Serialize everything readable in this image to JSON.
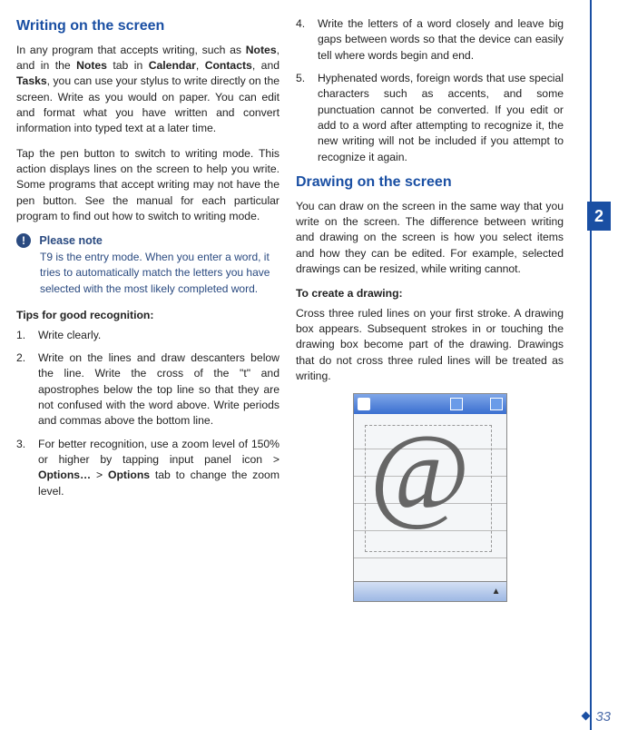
{
  "col1": {
    "h_writing": "Writing on the screen",
    "p1a": "In any program that accepts writing, such as ",
    "p1b_bold": "Notes",
    "p1c": ", and in the ",
    "p1d_bold": "Notes",
    "p1e": " tab in ",
    "p1f_bold": "Calendar",
    "p1g": ", ",
    "p1h_bold": "Contacts",
    "p1i": ", and ",
    "p1j_bold": "Tasks",
    "p1k": ", you can use your stylus to write directly on the screen. Write as you would on paper. You can edit and format what you have written and convert information into typed text at a later time.",
    "p2": "Tap the pen button to switch to writing mode. This action displays lines on the screen to help you write. Some programs that accept writing may not have the pen button. See the manual for each particular program to find out how to switch to writing mode.",
    "note_title": "Please note",
    "note_body": "T9 is the entry mode. When you enter a word, it tries to automatically match the letters you have selected with the most likely completed word.",
    "tips_head": "Tips for good recognition:",
    "li1": "Write clearly.",
    "li2": "Write on the lines and draw descanters below the line. Write the cross of the \"t\" and apostrophes below the top line so that they are not confused with the word above. Write periods and commas above the bottom line.",
    "li3a": "For better recognition, use a zoom level of 150% or higher by tapping input panel icon > ",
    "li3b_bold": "Options…",
    "li3c": " > ",
    "li3d_bold": "Options",
    "li3e": " tab to change the zoom level."
  },
  "col2": {
    "li4": "Write the letters of a word closely and leave big gaps between words so that the device can easily tell where words begin and end.",
    "li5": "Hyphenated words, foreign words that use special characters such as accents, and some punctuation cannot be converted. If you edit or add to a word after attempting to recognize it, the new writing will not be included if you attempt to recognize it again.",
    "h_drawing": "Drawing on the screen",
    "p_draw": "You can draw on the screen in the same way that you write on the screen. The difference between writing and drawing on the screen is how you select items and how they can be edited. For example, selected drawings can be resized, while writing cannot.",
    "create_head": "To create a drawing:",
    "p_cross": "Cross three ruled lines on your first stroke. A drawing box appears. Subsequent strokes in or touching the drawing box become part of the drawing. Drawings that do not cross three ruled lines will be treated as writing."
  },
  "rail": {
    "chapter": "2",
    "page": "33"
  }
}
